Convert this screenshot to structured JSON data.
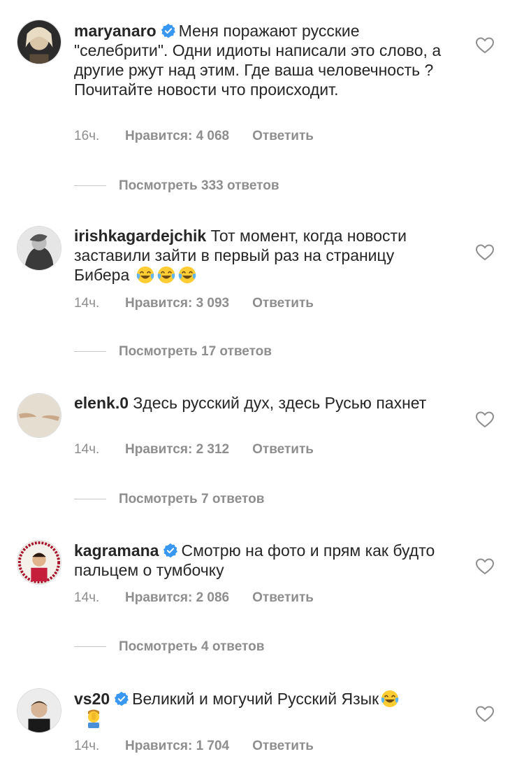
{
  "comments": [
    {
      "username": "maryanaro",
      "verified": true,
      "text": "Меня поражают русские \"селебрити\". Одни идиоты написали это слово, а другие ржут над этим. Где ваша человечность ? Почитайте новости что происходит.",
      "time": "16ч.",
      "likes": "Нравится: 4 068",
      "reply": "Ответить",
      "view_replies": "Посмотреть 333 ответов"
    },
    {
      "username": "irishkagardejchik",
      "verified": false,
      "text": "Тот момент, когда новости заставили зайти в первый раз  на страницу Бибера",
      "emoji": [
        "tears-of-joy",
        "tears-of-joy",
        "tears-of-joy"
      ],
      "time": "14ч.",
      "likes": "Нравится: 3 093",
      "reply": "Ответить",
      "view_replies": "Посмотреть 17 ответов"
    },
    {
      "username": "elenk.0",
      "verified": false,
      "text": "Здесь русский дух, здесь Русью пахнет",
      "time": "14ч.",
      "likes": "Нравится: 2 312",
      "reply": "Ответить",
      "view_replies": "Посмотреть 7 ответов"
    },
    {
      "username": "kagramana",
      "verified": true,
      "text": "Смотрю на фото и прям как будто пальцем о тумбочку",
      "time": "14ч.",
      "likes": "Нравится: 2 086",
      "reply": "Ответить",
      "view_replies": "Посмотреть 4 ответов"
    },
    {
      "username": "vs20",
      "verified": true,
      "text": "Великий и могучий Русский Язык",
      "emoji": [
        "tears-of-joy",
        "man-facepalming"
      ],
      "time": "14ч.",
      "likes": "Нравится: 1 704",
      "reply": "Ответить"
    }
  ],
  "colors": {
    "text": "#262626",
    "meta": "#8e8e8e",
    "verified": "#3897f0",
    "emoji_face": "#ffcc33"
  },
  "icons": {
    "like": "heart-outline-icon",
    "verified": "verified-badge-icon"
  }
}
